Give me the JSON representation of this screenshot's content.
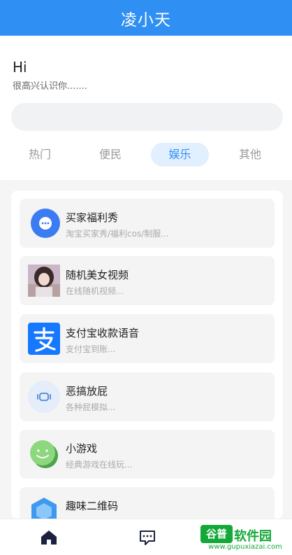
{
  "header": {
    "title": "凌小天"
  },
  "intro": {
    "greeting": "Hi",
    "subtitle": "很高兴认识你......."
  },
  "search": {
    "placeholder": ""
  },
  "tabs": [
    {
      "label": "热门",
      "active": false
    },
    {
      "label": "便民",
      "active": false
    },
    {
      "label": "娱乐",
      "active": true
    },
    {
      "label": "其他",
      "active": false
    }
  ],
  "items": [
    {
      "title": "买家福利秀",
      "desc": "淘宝买家秀/福利cos/制服...",
      "icon": "chat-bubble-icon"
    },
    {
      "title": "随机美女视频",
      "desc": "在线随机视频...",
      "icon": "avatar-photo-icon"
    },
    {
      "title": "支付宝收款语音",
      "desc": "支付宝到账...",
      "icon": "alipay-icon"
    },
    {
      "title": "恶搞放屁",
      "desc": "各种屁模拟...",
      "icon": "speaker-icon"
    },
    {
      "title": "小游戏",
      "desc": "经典游戏在线玩...",
      "icon": "game-smiley-icon"
    },
    {
      "title": "趣味二维码",
      "desc": "",
      "icon": "qr-hexagon-icon"
    }
  ],
  "nav": {
    "home_icon": "home-icon",
    "message_icon": "message-icon"
  },
  "watermark": {
    "logo": "谷普",
    "text": "软件园",
    "url": "www.gupuxiazai.com"
  },
  "colors": {
    "primary": "#2f8ff3",
    "active_tab_bg": "#e2efff",
    "watermark_green": "#13a838"
  }
}
